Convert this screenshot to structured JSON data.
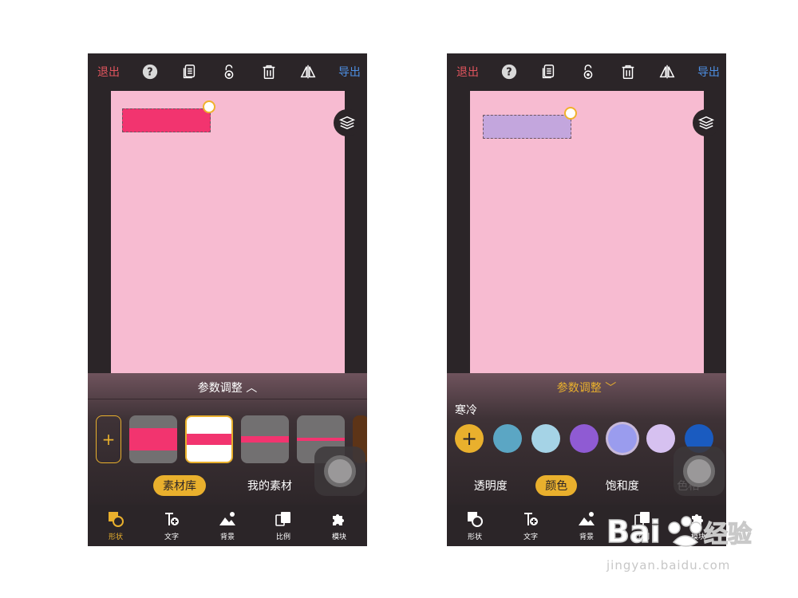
{
  "left_screen": {
    "topbar": {
      "exit": "退出",
      "export": "导出"
    },
    "shape_color": "#f2346f",
    "params_title": "参数调整",
    "params_arrow": "up",
    "subtabs": [
      "素材库",
      "我的素材"
    ],
    "active_subtab": "素材库",
    "nav": [
      {
        "label": "形状",
        "icon": "shape-icon",
        "active": true
      },
      {
        "label": "文字",
        "icon": "text-add-icon",
        "active": false
      },
      {
        "label": "背景",
        "icon": "landscape-icon",
        "active": false
      },
      {
        "label": "比例",
        "icon": "ratio-icon",
        "active": false
      },
      {
        "label": "模块",
        "icon": "puzzle-icon",
        "active": false
      }
    ]
  },
  "right_screen": {
    "topbar": {
      "exit": "退出",
      "export": "导出"
    },
    "shape_color": "#c3a6dd",
    "params_title": "参数调整",
    "params_arrow": "down",
    "color_group": "寒冷",
    "swatches": [
      "#5ba6c4",
      "#a5d3e6",
      "#8f5bd3",
      "#9a9cee",
      "#d6c1f0",
      "#1a5bc0"
    ],
    "selected_swatch": "#9a9cee",
    "tabs": [
      "透明度",
      "颜色",
      "饱和度",
      "色相"
    ],
    "active_tab": "颜色",
    "nav": [
      {
        "label": "形状",
        "icon": "shape-icon",
        "active": false
      },
      {
        "label": "文字",
        "icon": "text-add-icon",
        "active": false
      },
      {
        "label": "背景",
        "icon": "landscape-icon",
        "active": false
      },
      {
        "label": "比例",
        "icon": "ratio-icon",
        "active": false
      },
      {
        "label": "模块",
        "icon": "puzzle-icon",
        "active": false
      }
    ]
  },
  "watermark": {
    "text": "jingyan.baidu.com",
    "brand": "Bai 经验"
  },
  "colors": {
    "accent": "#e9b02d",
    "canvas": "#f7bbd1",
    "phone_bg": "#2b2528"
  }
}
